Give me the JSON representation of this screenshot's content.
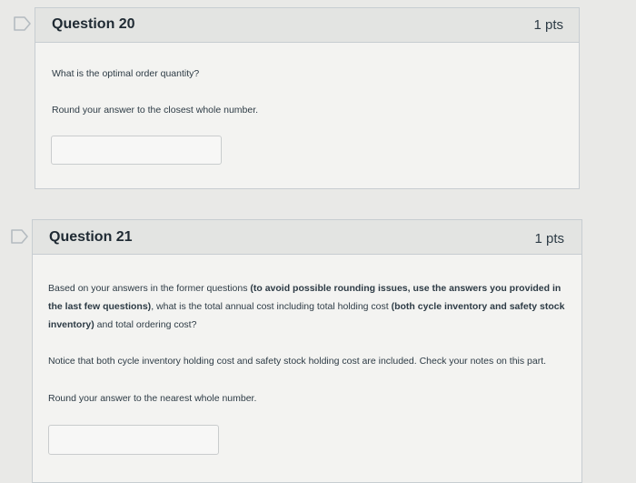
{
  "questions": [
    {
      "title": "Question 20",
      "points": "1 pts",
      "paragraphs": [
        "What is the optimal order quantity?",
        "Round your answer to the closest whole number."
      ],
      "answer_value": ""
    },
    {
      "title": "Question 21",
      "points": "1 pts",
      "paragraph1": {
        "part1": "Based on your answers in the former questions ",
        "bold1": "(to avoid possible rounding issues, use the answers you provided in the last few questions)",
        "part2": ", what is the total annual cost including total holding cost ",
        "bold2": "(both cycle inventory and safety stock",
        "bold2b": " inventory)",
        "part3": " and total ordering cost?"
      },
      "paragraphs": [
        "Notice that both cycle inventory holding cost and safety stock holding cost are included. Check your notes on this part.",
        "Round your answer to the nearest whole number."
      ],
      "answer_value": ""
    }
  ],
  "colors": {
    "flag_outline": "#9aa3a8",
    "page_background": "#e9e9e7",
    "header_background": "#e3e4e2",
    "card_background": "#f3f3f1"
  },
  "icons": {
    "flag": "flag-question-icon"
  }
}
